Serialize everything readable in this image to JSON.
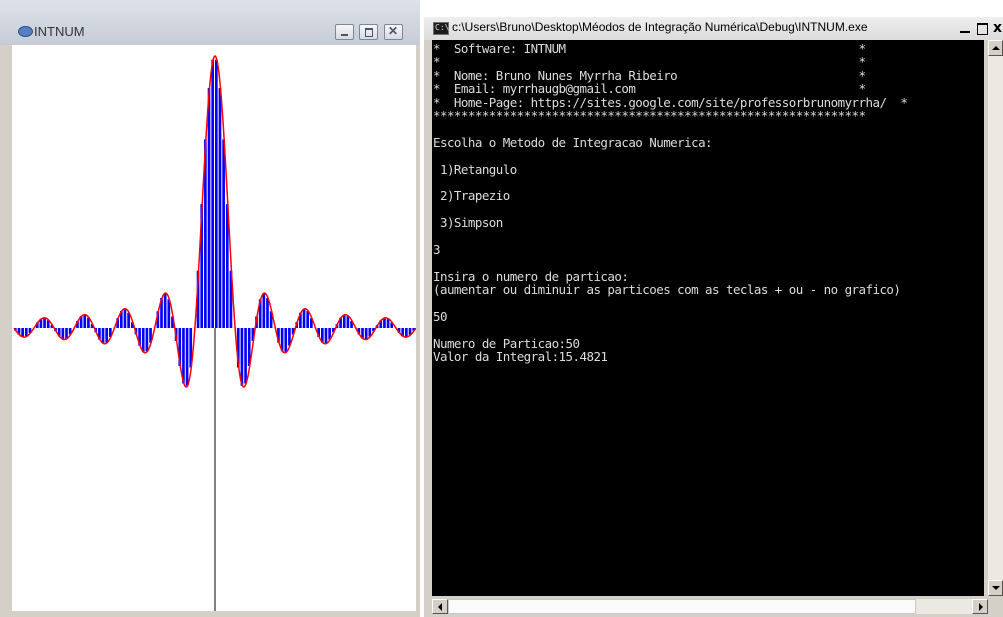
{
  "graph_window": {
    "title": "INTNUM",
    "icon": "eye-icon",
    "controls": {
      "minimize": "minimize-icon",
      "maximize": "maximize-icon",
      "close": "✕"
    }
  },
  "plot": {
    "function": "sin(x)/x",
    "x_range": [
      -31.4,
      31.4
    ],
    "partitions": 50,
    "fill_color": "#0000ff",
    "curve_color": "#ff0000",
    "axis_color": "#000000"
  },
  "console_window": {
    "title": "c:\\Users\\Bruno\\Desktop\\Méodos de Integração Numérica\\Debug\\INTNUM.exe",
    "icon": "cmd-icon",
    "background": "#000000",
    "foreground": "#dcdcdc",
    "lines": [
      "*  Software: INTNUM                                          *",
      "*                                                            *",
      "*  Nome: Bruno Nunes Myrrha Ribeiro                          *",
      "*  Email: myrrhaugb@gmail.com                                *",
      "*  Home-Page: https://sites.google.com/site/professorbrunomyrrha/  *",
      "**************************************************************",
      "",
      "Escolha o Metodo de Integracao Numerica:",
      "",
      " 1)Retangulo",
      "",
      " 2)Trapezio",
      "",
      " 3)Simpson",
      "",
      "3",
      "",
      "Insira o numero de particao:",
      "(aumentar ou diminuir as particoes com as teclas + ou - no grafico)",
      "",
      "50",
      "",
      "Numero de Particao:50",
      "Valor da Integral:15.4821"
    ]
  }
}
